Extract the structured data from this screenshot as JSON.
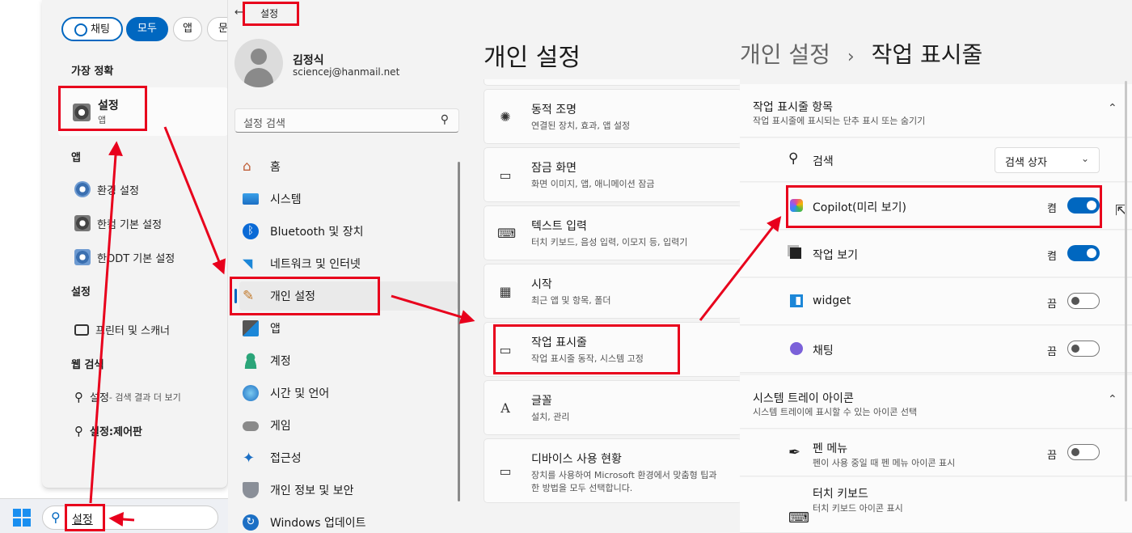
{
  "search": {
    "chips": [
      "채팅",
      "모두",
      "앱",
      "문"
    ],
    "best_match_heading": "가장 정확",
    "best_match": {
      "title": "설정",
      "subtitle": "앱"
    },
    "apps_heading": "앱",
    "apps": [
      "환경 설정",
      "한컴 기본 설정",
      "한ODT 기본 설정"
    ],
    "settings_heading": "설정",
    "settings_items": [
      "프린터 및 스캐너"
    ],
    "web_heading": "웹 검색",
    "web_items": [
      {
        "main": "설정",
        "suffix": " - 검색 결과 더 보기"
      },
      {
        "main": "설정:제어판",
        "suffix": ""
      }
    ]
  },
  "taskbar": {
    "query": "설정"
  },
  "settings": {
    "window_title": "설정",
    "user_name": "김정식",
    "user_email": "sciencej@hanmail.net",
    "search_placeholder": "설정 검색",
    "nav": [
      "홈",
      "시스템",
      "Bluetooth 및 장치",
      "네트워크 및 인터넷",
      "개인 설정",
      "앱",
      "계정",
      "시간 및 언어",
      "게임",
      "접근성",
      "개인 정보 및 보안",
      "Windows 업데이트"
    ]
  },
  "personalization": {
    "title": "개인 설정",
    "cards": [
      {
        "title": "동적 조명",
        "sub": "연결된 장치, 효과, 앱 설정",
        "icon": "sun-icon"
      },
      {
        "title": "잠금 화면",
        "sub": "화면 이미지, 앱, 애니메이션 잠금",
        "icon": "lock-screen-icon"
      },
      {
        "title": "텍스트 입력",
        "sub": "터치 키보드, 음성 입력, 이모지 등, 입력기",
        "icon": "keyboard-icon"
      },
      {
        "title": "시작",
        "sub": "최근 앱 및 항목, 폴더",
        "icon": "start-icon"
      },
      {
        "title": "작업 표시줄",
        "sub": "작업 표시줄 동작, 시스템 고정",
        "icon": "taskbar-icon"
      },
      {
        "title": "글꼴",
        "sub": "설치, 관리",
        "icon": "font-icon"
      },
      {
        "title": "디바이스 사용 현황",
        "sub": "장치를 사용하여 Microsoft 환경에서 맞춤형 팁과",
        "sub2": "한 방법을 모두 선택합니다.",
        "icon": "device-usage-icon"
      }
    ]
  },
  "taskbar_settings": {
    "breadcrumb_parent": "개인 설정",
    "breadcrumb_sep": "›",
    "breadcrumb_current": "작업 표시줄",
    "items_section": {
      "title": "작업 표시줄 항목",
      "sub": "작업 표시줄에 표시되는 단추 표시 또는 숨기기"
    },
    "search_row": {
      "label": "검색",
      "value": "검색 상자"
    },
    "toggles": [
      {
        "label": "Copilot(미리 보기)",
        "state": "켬",
        "on": true
      },
      {
        "label": "작업 보기",
        "state": "켬",
        "on": true
      },
      {
        "label": "widget",
        "state": "끔",
        "on": false
      },
      {
        "label": "채팅",
        "state": "끔",
        "on": false
      }
    ],
    "tray_section": {
      "title": "시스템 트레이 아이콘",
      "sub": "시스템 트레이에 표시할 수 있는 아이콘 선택"
    },
    "pen_menu": {
      "title": "펜 메뉴",
      "sub": "펜이 사용 중일 때 펜 메뉴 아이콘 표시",
      "state": "끔"
    },
    "touch_keyboard": {
      "title": "터치 키보드",
      "sub": "터치 키보드 아이콘 표시"
    }
  },
  "colors": {
    "annotation": "#e8001c",
    "accent": "#0067c0"
  }
}
